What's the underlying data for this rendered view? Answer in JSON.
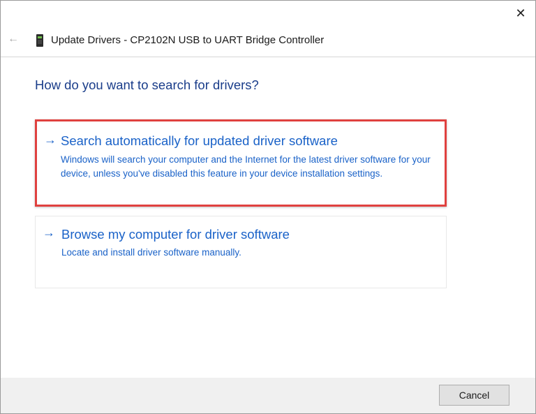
{
  "window": {
    "title": "Update Drivers - CP2102N USB to UART Bridge Controller",
    "close_glyph": "✕",
    "back_glyph": "←"
  },
  "main": {
    "question": "How do you want to search for drivers?",
    "options": [
      {
        "arrow": "→",
        "title": "Search automatically for updated driver software",
        "description": "Windows will search your computer and the Internet for the latest driver software for your device, unless you've disabled this feature in your device installation settings.",
        "highlighted": true
      },
      {
        "arrow": "→",
        "title": "Browse my computer for driver software",
        "description": "Locate and install driver software manually.",
        "highlighted": false
      }
    ]
  },
  "footer": {
    "cancel_label": "Cancel"
  },
  "colors": {
    "link_blue": "#1a62c8",
    "heading_blue": "#1a3d8a",
    "highlight_red": "#e0413f",
    "footer_gray": "#f0f0f0"
  },
  "icons": {
    "back": "back-arrow-icon",
    "device": "usb-device-icon",
    "close": "close-icon",
    "option_arrow": "arrow-right-icon"
  }
}
